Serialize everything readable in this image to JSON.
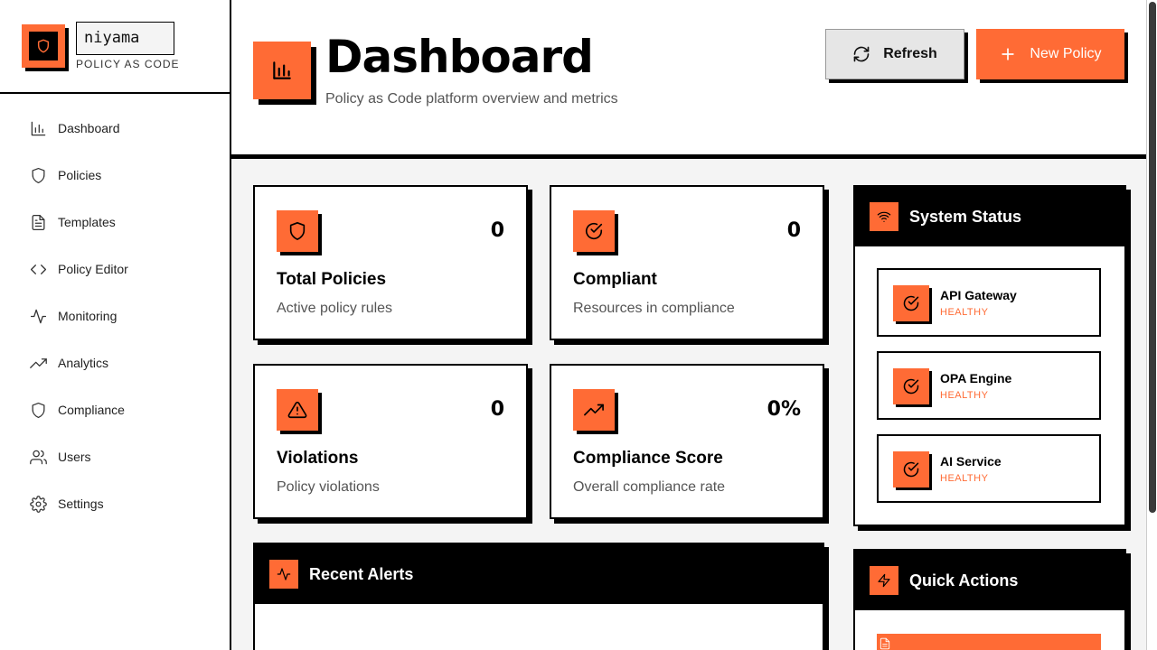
{
  "brand": {
    "name": "niyama",
    "tagline": "POLICY AS CODE"
  },
  "sidebar": {
    "items": [
      {
        "label": "Dashboard",
        "icon": "bar-chart-icon"
      },
      {
        "label": "Policies",
        "icon": "shield-icon"
      },
      {
        "label": "Templates",
        "icon": "file-text-icon"
      },
      {
        "label": "Policy Editor",
        "icon": "code-icon"
      },
      {
        "label": "Monitoring",
        "icon": "activity-icon"
      },
      {
        "label": "Analytics",
        "icon": "trending-up-icon"
      },
      {
        "label": "Compliance",
        "icon": "shield-icon"
      },
      {
        "label": "Users",
        "icon": "users-icon"
      },
      {
        "label": "Settings",
        "icon": "gear-icon"
      }
    ]
  },
  "header": {
    "title": "Dashboard",
    "subtitle": "Policy as Code platform overview and metrics",
    "refresh_label": "Refresh",
    "new_policy_label": "New Policy"
  },
  "stats": [
    {
      "value": "0",
      "label": "Total Policies",
      "desc": "Active policy rules",
      "icon": "shield-icon"
    },
    {
      "value": "0",
      "label": "Compliant",
      "desc": "Resources in compliance",
      "icon": "check-circle-icon"
    },
    {
      "value": "0",
      "label": "Violations",
      "desc": "Policy violations",
      "icon": "alert-triangle-icon"
    },
    {
      "value": "0%",
      "label": "Compliance Score",
      "desc": "Overall compliance rate",
      "icon": "trending-up-icon"
    }
  ],
  "recent_alerts": {
    "title": "Recent Alerts",
    "icon": "activity-icon"
  },
  "system_status": {
    "title": "System Status",
    "icon": "wifi-icon",
    "services": [
      {
        "name": "API Gateway",
        "status": "HEALTHY"
      },
      {
        "name": "OPA Engine",
        "status": "HEALTHY"
      },
      {
        "name": "AI Service",
        "status": "HEALTHY"
      }
    ]
  },
  "quick_actions": {
    "title": "Quick Actions",
    "icon": "zap-icon"
  },
  "colors": {
    "accent": "#ff6b35",
    "ink": "#000000",
    "background": "#f4f4f4",
    "surface": "#ffffff"
  }
}
